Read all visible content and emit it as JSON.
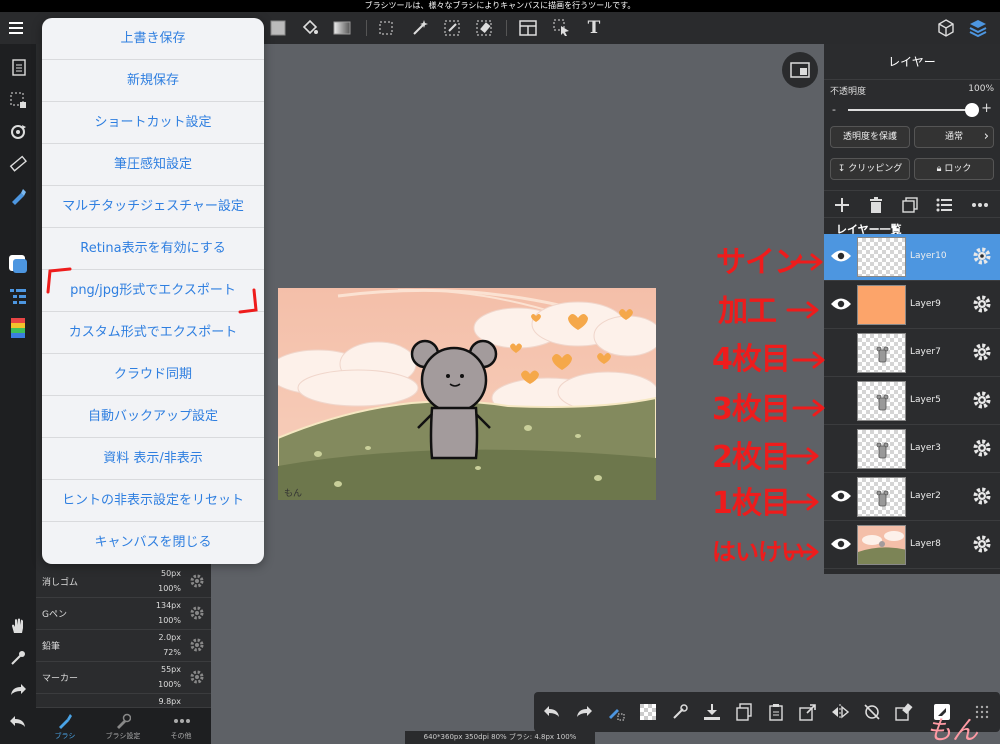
{
  "status_bar": {
    "text": "ブラシツールは、様々なブラシによりキャンバスに描画を行うツールです。"
  },
  "toolbar": {
    "text_tool_glyph": "T"
  },
  "main_menu": {
    "items": [
      "上書き保存",
      "新規保存",
      "ショートカット設定",
      "筆圧感知設定",
      "マルチタッチジェスチャー設定",
      "Retina表示を有効にする",
      "png/jpg形式でエクスポート",
      "カスタム形式でエクスポート",
      "クラウド同期",
      "自動バックアップ設定",
      "資料 表示/非表示",
      "ヒントの非表示設定をリセット",
      "キャンバスを閉じる"
    ],
    "highlighted_item": "png/jpg形式でエクスポート"
  },
  "brush_panel": {
    "brushes": [
      {
        "name": "消しゴム",
        "size": "50px",
        "opacity": "100%"
      },
      {
        "name": "Gペン",
        "size": "134px",
        "opacity": "100%"
      },
      {
        "name": "鉛筆",
        "size": "2.0px",
        "opacity": "72%"
      },
      {
        "name": "マーカー",
        "size": "55px",
        "opacity": "100%"
      },
      {
        "name": "",
        "size": "9.8px",
        "opacity": ""
      }
    ],
    "tabs": [
      {
        "label": "ブラシ",
        "active": true
      },
      {
        "label": "ブラシ設定",
        "active": false
      },
      {
        "label": "その他",
        "active": false
      }
    ]
  },
  "layer_panel": {
    "title": "レイヤー",
    "opacity_label": "不透明度",
    "opacity_value": "100%",
    "opacity_fraction": 1.0,
    "slider_minus": "-",
    "slider_plus": "+",
    "protect_alpha": "透明度を保護",
    "blend_mode": "通常",
    "clipping": "クリッピング",
    "lock": "ロック",
    "list_title": "レイヤー一覧",
    "layers": [
      {
        "name": "Layer10",
        "visible": true,
        "selected": true,
        "thumb": "empty"
      },
      {
        "name": "Layer9",
        "visible": true,
        "selected": false,
        "thumb": "orange"
      },
      {
        "name": "Layer7",
        "visible": false,
        "selected": false,
        "thumb": "mouse"
      },
      {
        "name": "Layer5",
        "visible": false,
        "selected": false,
        "thumb": "mouse"
      },
      {
        "name": "Layer3",
        "visible": false,
        "selected": false,
        "thumb": "mouse"
      },
      {
        "name": "Layer2",
        "visible": true,
        "selected": false,
        "thumb": "mouse"
      },
      {
        "name": "Layer8",
        "visible": true,
        "selected": false,
        "thumb": "scene"
      }
    ]
  },
  "annotations": [
    "サイン",
    "加工",
    "4枚目",
    "3枚目",
    "2枚目",
    "1枚目",
    "はいけい"
  ],
  "canvas": {
    "signature": "もん"
  },
  "canvas_info": "640*360px 350dpi 80% ブラシ: 4.8px 100%",
  "watermark": "もん",
  "colors": {
    "accent": "#4d96e0",
    "menu_text": "#2f7fe0",
    "annotation": "#ee1c1c",
    "layer9_fill": "#fca46a"
  }
}
